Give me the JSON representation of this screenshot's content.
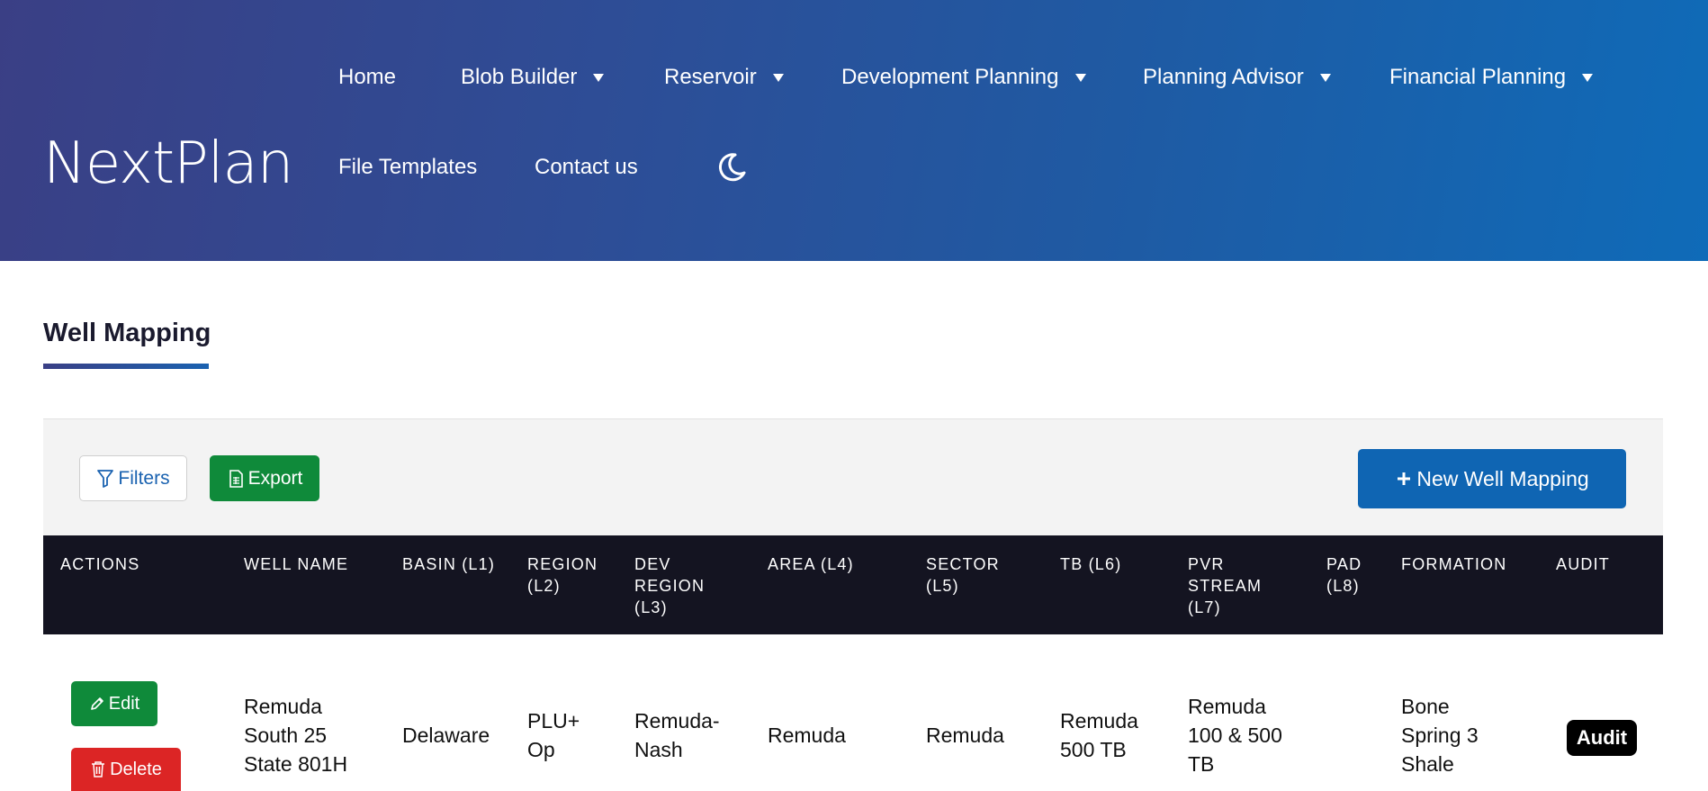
{
  "app": {
    "logo": "NextPlan"
  },
  "nav": {
    "home": "Home",
    "blob_builder": "Blob Builder",
    "reservoir": "Reservoir",
    "development_planning": "Development Planning",
    "planning_advisor": "Planning Advisor",
    "financial_planning": "Financial Planning",
    "file_templates": "File Templates",
    "contact_us": "Contact us",
    "theme_icon": "moon-icon"
  },
  "page": {
    "title": "Well Mapping"
  },
  "toolbar": {
    "filters_label": "Filters",
    "export_label": "Export",
    "new_label": "New Well Mapping"
  },
  "table": {
    "headers": {
      "actions": "ACTIONS",
      "well_name": "WELL NAME",
      "basin_1": "BASIN (L1)",
      "region_1": "REGION",
      "region_2": "(L2)",
      "dev_1": "DEV",
      "dev_2": "REGION",
      "dev_3": "(L3)",
      "area": "AREA (L4)",
      "sector_1": "SECTOR",
      "sector_2": "(L5)",
      "tb": "TB (L6)",
      "pvr_1": "PVR",
      "pvr_2": "STREAM",
      "pvr_3": "(L7)",
      "pad_1": "PAD",
      "pad_2": "(L8)",
      "formation": "FORMATION",
      "audit": "AUDIT"
    },
    "rows": [
      {
        "edit_label": "Edit",
        "delete_label": "Delete",
        "well_name_1": "Remuda",
        "well_name_2": "South 25",
        "well_name_3": "State 801H",
        "basin": "Delaware",
        "region_1": "PLU+",
        "region_2": "Op",
        "dev_region_1": "Remuda-",
        "dev_region_2": "Nash",
        "area": "Remuda",
        "sector": "Remuda",
        "tb_1": "Remuda",
        "tb_2": "500 TB",
        "pvr_1": "Remuda",
        "pvr_2": "100 & 500",
        "pvr_3": "TB",
        "pad": "",
        "formation_1": "Bone",
        "formation_2": "Spring 3",
        "formation_3": "Shale",
        "audit_label": "Audit"
      }
    ]
  },
  "colors": {
    "header_start": "#3a3f85",
    "header_end": "#0f6bb8",
    "green": "#0f8a3a",
    "red": "#dc2525",
    "blue": "#0f65b3",
    "table_header": "#141421"
  }
}
